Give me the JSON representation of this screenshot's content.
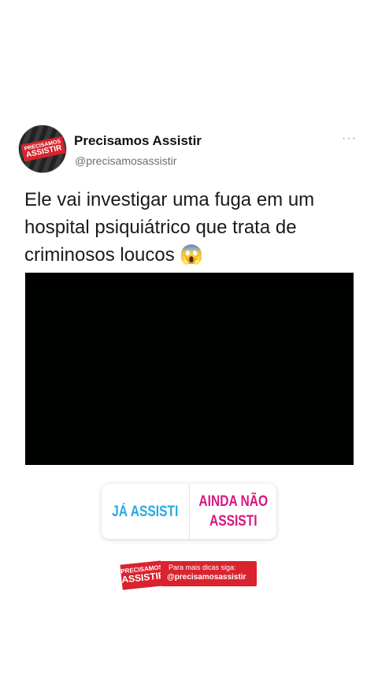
{
  "tweet": {
    "avatar_line1": "PRECISAMOS",
    "avatar_line2": "ASSISTIR",
    "display_name": "Precisamos Assistir",
    "handle": "@precisamosassistir",
    "more_label": "···",
    "text": "Ele vai investigar uma fuga em um hospital psiquiátrico que trata de criminosos loucos 😱"
  },
  "poll": {
    "option_yes": "JÁ ASSISTI",
    "option_no": "AINDA NÃO ASSISTI"
  },
  "footer_badge": {
    "logo_line1": "PRECISAMOS",
    "logo_line2": "ASSISTIR",
    "text_line1": "Para mais dicas siga:",
    "text_line2": "@precisamosassistir"
  },
  "colors": {
    "brand_red": "#d9232e",
    "poll_yes": "#27a9e1",
    "poll_no": "#d6177e",
    "video_bg": "#000200"
  }
}
